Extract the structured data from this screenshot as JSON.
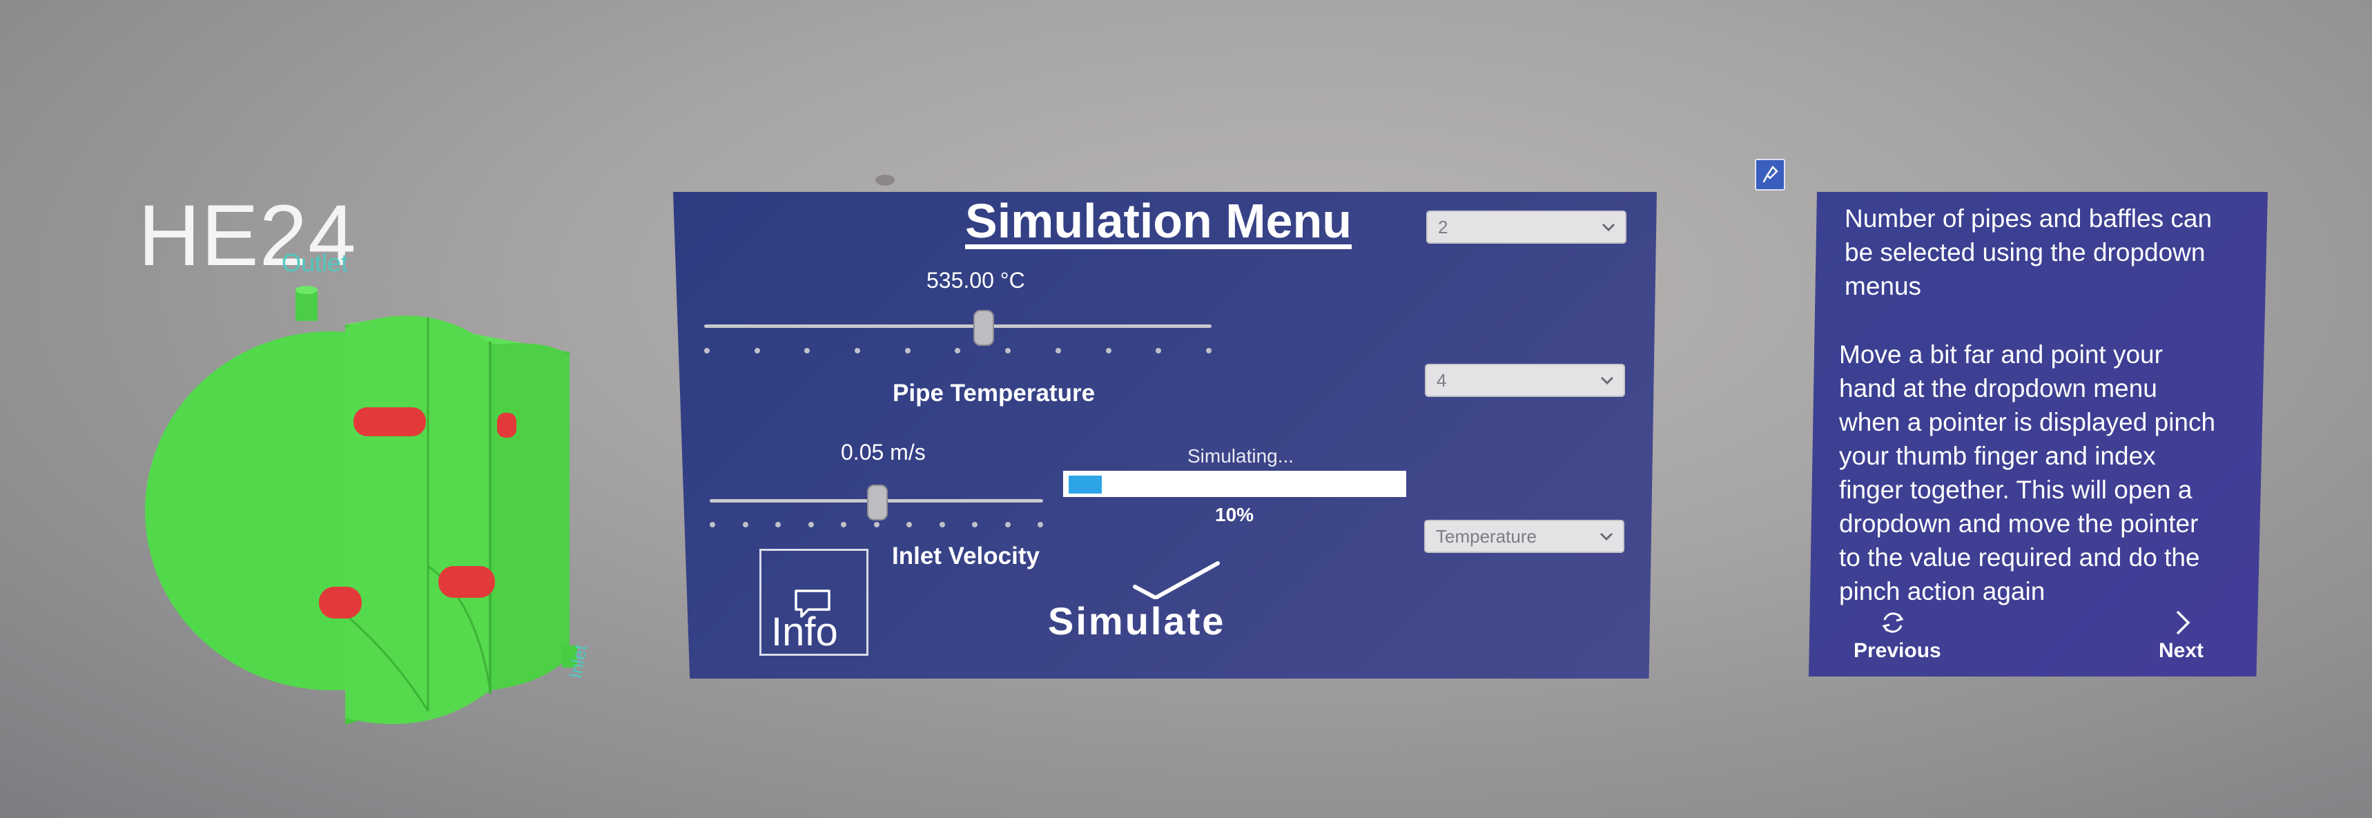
{
  "model": {
    "title": "HE24",
    "outlet_label": "Outlet",
    "inlet_label": "Inlet",
    "icon": "heat-exchanger-model"
  },
  "simulation": {
    "title": "Simulation Menu",
    "pipe_temperature": {
      "value_text": "535.00 °C",
      "label": "Pipe Temperature",
      "slider_fraction": 0.55
    },
    "inlet_velocity": {
      "value_text": "0.05 m/s",
      "label": "Inlet Velocity",
      "slider_fraction": 0.5
    },
    "status_text": "Simulating...",
    "progress_percent": 10,
    "progress_text": "10%",
    "info_label": "Info",
    "simulate_label": "Simulate",
    "dropdowns": [
      {
        "value": "2"
      },
      {
        "value": "4"
      },
      {
        "value": "Temperature"
      }
    ]
  },
  "instructions": {
    "paragraph1": [
      "Number of pipes and baffles can",
      "be selected using the dropdown",
      "menus"
    ],
    "paragraph2": [
      "Move a bit far and point your",
      "hand at the dropdown menu",
      "when a pointer is displayed pinch",
      "your thumb finger and index",
      "finger together. This will open a",
      "dropdown and move the pointer",
      "to the value required and do the",
      "pinch action again"
    ],
    "previous_label": "Previous",
    "next_label": "Next"
  },
  "colors": {
    "panel": "#34408a",
    "model_green": "#4fd94a",
    "baffle_red": "#e63b3b",
    "progress": "#2da4e6"
  }
}
